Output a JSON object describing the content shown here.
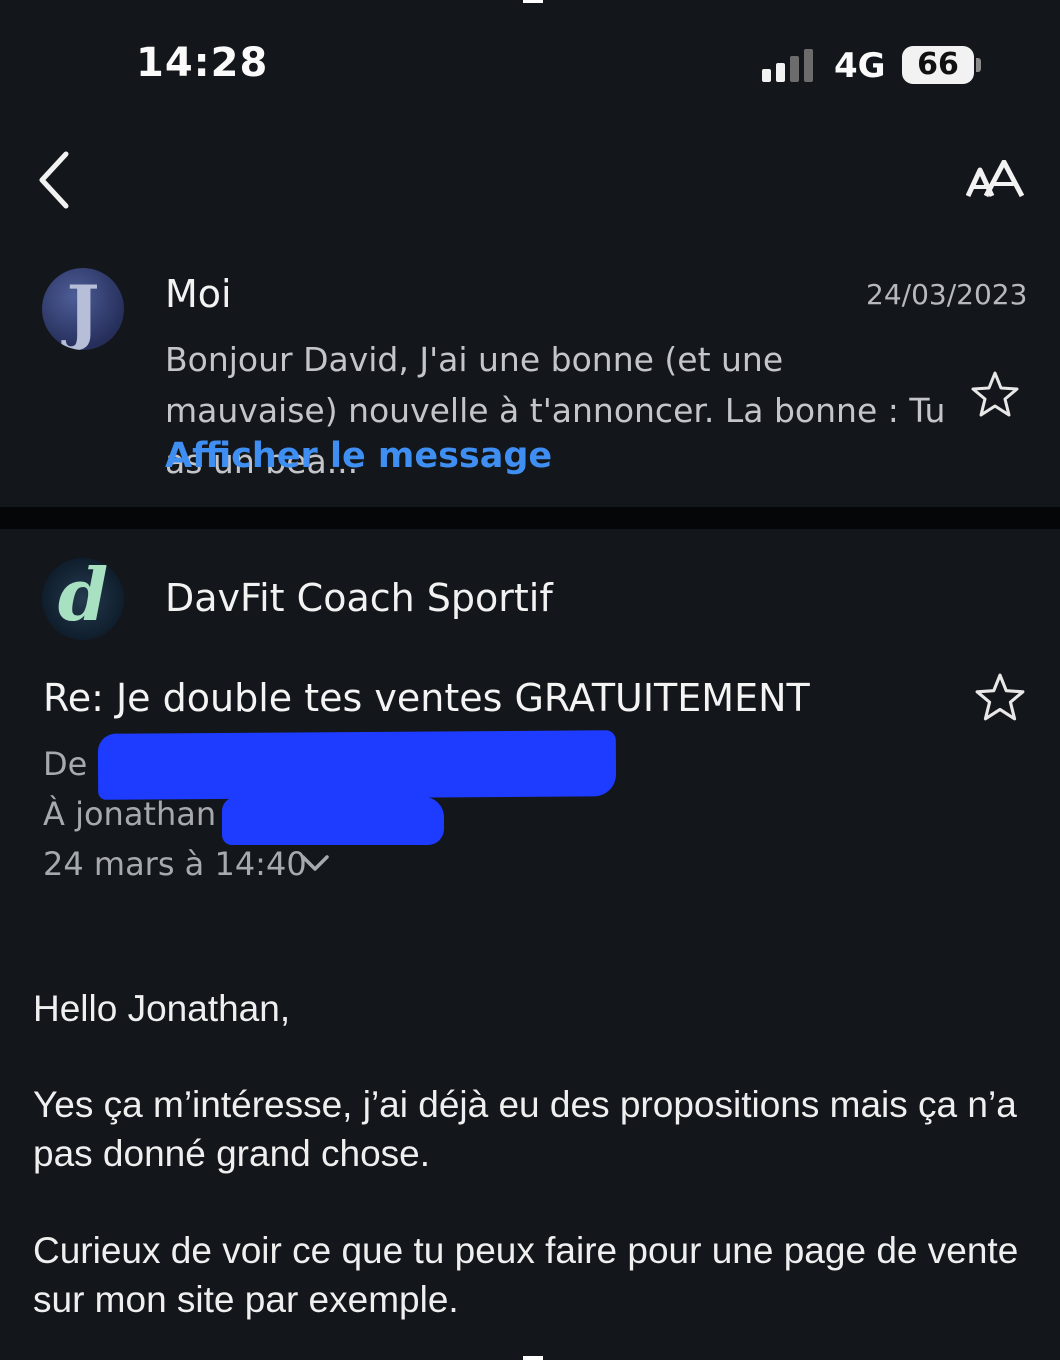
{
  "status_bar": {
    "time": "14:28",
    "network": "4G",
    "battery": "66"
  },
  "nav": {
    "back_icon": "chevron-left-icon",
    "text_size_icon": "text-size-icon"
  },
  "preview": {
    "sender": "Moi",
    "date": "24/03/2023",
    "snippet": "Bonjour David, J'ai une bonne (et une mauvaise) nouvelle à t'annoncer. La bonne : Tu as un bea...",
    "show_message_label": "Afficher le message",
    "avatar_letter": "J"
  },
  "email": {
    "sender": "DavFit Coach Sportif",
    "avatar_letter": "d",
    "subject": "Re: Je double tes ventes GRATUITEMENT",
    "from": "De c",
    "to": "À jonathan",
    "datetime": "24 mars à 14:40",
    "body": {
      "greeting": "Hello Jonathan,",
      "paragraph1": "Yes ça m’intéresse, j’ai déjà eu des propositions mais ça n’a pas donné grand chose.",
      "paragraph2": "Curieux de voir ce que tu peux faire pour une page de vente sur mon site par exemple."
    }
  },
  "colors": {
    "accent": "#3f8ef2",
    "background": "#13161a",
    "redaction": "#1d3cff"
  }
}
